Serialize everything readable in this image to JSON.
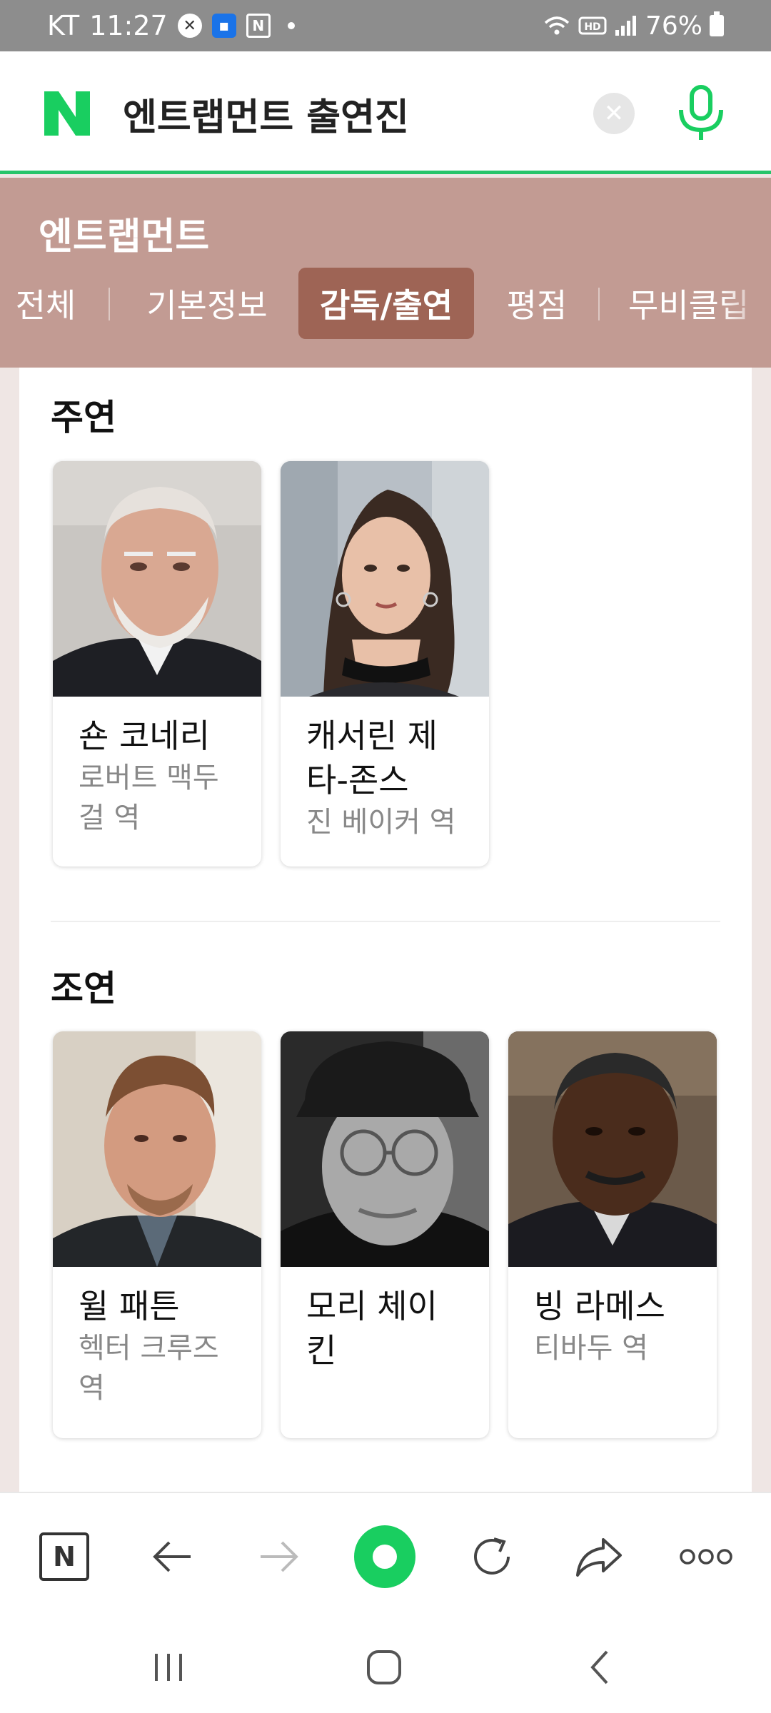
{
  "status_bar": {
    "carrier": "KT",
    "time": "11:27",
    "battery": "76%",
    "icons": [
      "x-app-icon",
      "folder-app-icon",
      "n-app-icon",
      "dot-icon",
      "wifi-icon",
      "hd-icon",
      "signal-icon",
      "battery-icon"
    ]
  },
  "search": {
    "query": "엔트랩먼트 출연진",
    "clear_icon": "close-icon",
    "mic_icon": "microphone-icon"
  },
  "header": {
    "title": "엔트랩먼트",
    "tabs": [
      {
        "label": "전체"
      },
      {
        "label": "기본정보"
      },
      {
        "label": "감독/출연"
      },
      {
        "label": "평점"
      },
      {
        "label": "무비클립"
      }
    ],
    "active_tab": "감독/출연"
  },
  "main_cast": {
    "title": "주연",
    "people": [
      {
        "name": "숀 코네리",
        "role": "로버트 맥두걸 역"
      },
      {
        "name": "캐서린 제타-존스",
        "role": "진 베이커 역"
      }
    ]
  },
  "supporting_cast": {
    "title": "조연",
    "people": [
      {
        "name": "윌 패튼",
        "role": "헥터 크루즈 역"
      },
      {
        "name": "모리 체이킨",
        "role": ""
      },
      {
        "name": "빙 라메스",
        "role": "티바두 역"
      }
    ]
  },
  "toolbar": {
    "items": [
      "naver-home-icon",
      "back-arrow-icon",
      "forward-arrow-icon",
      "green-dot-icon",
      "refresh-icon",
      "share-icon",
      "more-icon"
    ]
  },
  "nav": {
    "items": [
      "recent-apps-icon",
      "home-icon",
      "back-icon"
    ]
  },
  "colors": {
    "brand_green": "#19ce60",
    "header_bg": "#c29b93",
    "active_tab_bg": "#9e6455"
  }
}
